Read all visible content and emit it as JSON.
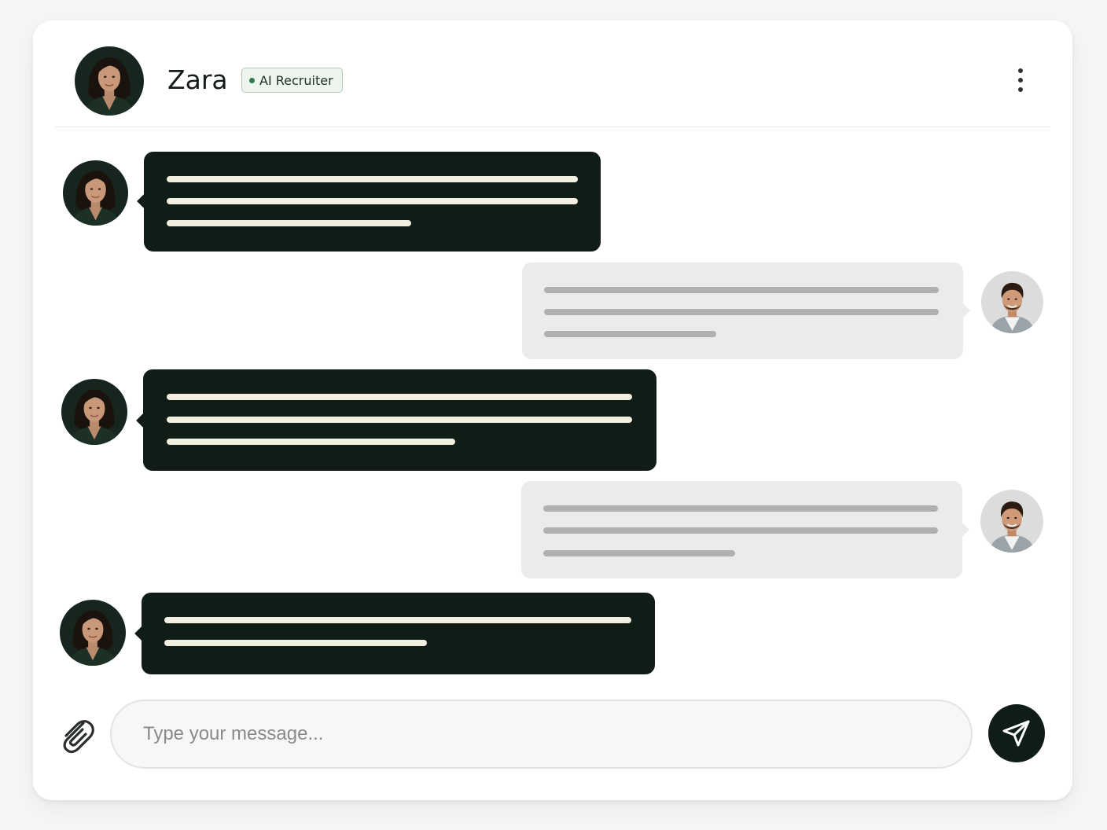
{
  "header": {
    "name": "Zara",
    "badge": "AI Recruiter",
    "avatar_icon": "woman-portrait-avatar",
    "menu_icon": "more-vertical-icon"
  },
  "messages": [
    {
      "sender": "ai",
      "text_lines": 3,
      "avatar_icon": "woman-portrait-avatar"
    },
    {
      "sender": "user",
      "text_lines": 3,
      "avatar_icon": "man-portrait-avatar"
    },
    {
      "sender": "ai",
      "text_lines": 3,
      "avatar_icon": "woman-portrait-avatar"
    },
    {
      "sender": "user",
      "text_lines": 3,
      "avatar_icon": "man-portrait-avatar"
    },
    {
      "sender": "ai",
      "text_lines": 2,
      "avatar_icon": "woman-portrait-avatar"
    }
  ],
  "composer": {
    "placeholder": "Type your message...",
    "value": "",
    "attach_icon": "paperclip-icon",
    "send_icon": "send-icon"
  },
  "colors": {
    "ai_bubble": "#0f1d16",
    "ai_text_line": "#f3efe0",
    "user_bubble": "#ebebeb",
    "user_text_line": "#b0b0b0",
    "badge_dot": "#2c7a4e",
    "send_button": "#0f1d16"
  }
}
